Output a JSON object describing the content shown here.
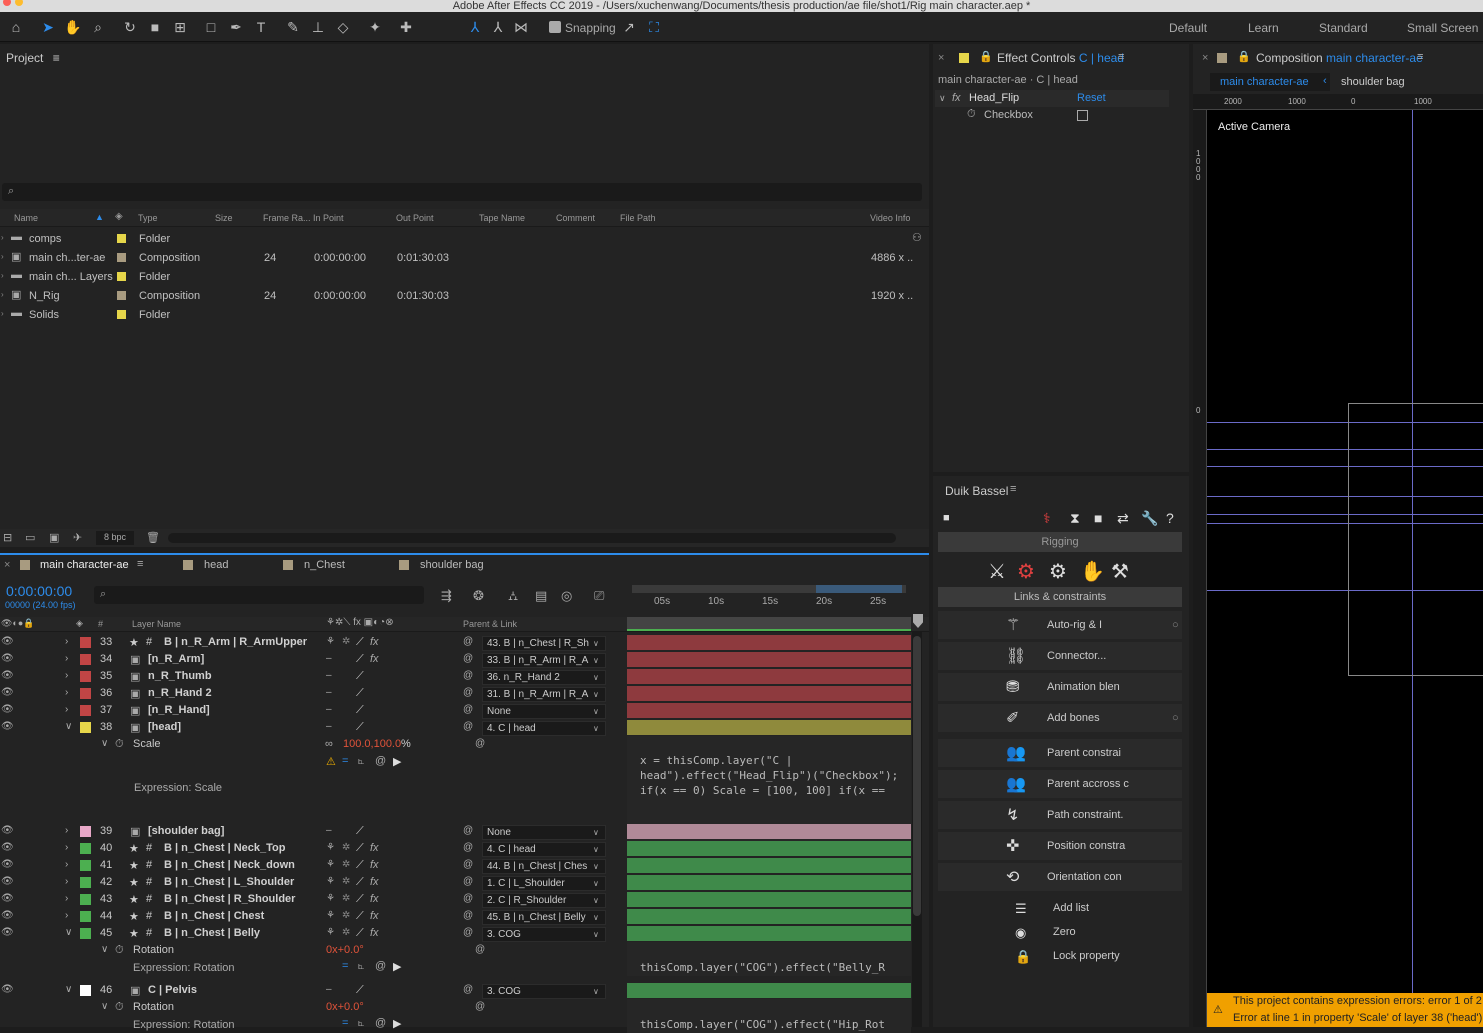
{
  "app": {
    "title": "Adobe After Effects CC 2019 - /Users/xuchenwang/Documents/thesis production/ae file/shot1/Rig main character.aep *"
  },
  "toolbar": {
    "snapping": "Snapping",
    "workspaces": [
      "Default",
      "Learn",
      "Standard",
      "Small Screen"
    ]
  },
  "project": {
    "title": "Project",
    "bpc": "8 bpc",
    "columns": [
      "Name",
      "Type",
      "Size",
      "Frame Ra...",
      "In Point",
      "Out Point",
      "Tape Name",
      "Comment",
      "File Path",
      "Video Info"
    ],
    "rows": [
      {
        "name": "comps",
        "type": "Folder",
        "fps": "",
        "in": "",
        "out": "",
        "info": "",
        "color": "#e6d64a"
      },
      {
        "name": "main ch...ter-ae",
        "type": "Composition",
        "fps": "24",
        "in": "0:00:00:00",
        "out": "0:01:30:03",
        "info": "4886 x ..",
        "color": "#a89b80"
      },
      {
        "name": "main ch... Layers",
        "type": "Folder",
        "fps": "",
        "in": "",
        "out": "",
        "info": "",
        "color": "#e6d64a"
      },
      {
        "name": "N_Rig",
        "type": "Composition",
        "fps": "24",
        "in": "0:00:00:00",
        "out": "0:01:30:03",
        "info": "1920 x ..",
        "color": "#a89b80"
      },
      {
        "name": "Solids",
        "type": "Folder",
        "fps": "",
        "in": "",
        "out": "",
        "info": "",
        "color": "#e6d64a"
      }
    ]
  },
  "effect_controls": {
    "tab": "Effect Controls",
    "tab_highlight": "C | head",
    "breadcrumb": "main character-ae · C | head",
    "effect": "Head_Flip",
    "reset": "Reset",
    "param": "Checkbox"
  },
  "composition": {
    "tab": "Composition",
    "tab_highlight": "main character-ae",
    "crumb1": "main character-ae",
    "crumb2": "shoulder bag",
    "ruler": [
      "2000",
      "1000",
      "0",
      "1000"
    ],
    "camera": "Active Camera",
    "vruler": "1 0 0 0",
    "vruler2": "0",
    "error1": "This project contains expression errors: error 1 of 2",
    "error2": "Error at line 1 in property 'Scale' of layer 38 ('head')"
  },
  "duik": {
    "title": "Duik Bassel",
    "rigging": "Rigging",
    "links": "Links & constraints",
    "buttons": [
      "Auto-rig & I",
      "Connector...",
      "Animation blen",
      "Add bones",
      "Parent constrai",
      "Parent accross c",
      "Path constraint.",
      "Position constra",
      "Orientation con"
    ],
    "extra": [
      "Add list",
      "Zero",
      "Lock property"
    ]
  },
  "timeline": {
    "tabs": [
      "main character-ae",
      "head",
      "n_Chest",
      "shoulder bag"
    ],
    "timecode": "0:00:00:00",
    "fps": "00000 (24.00 fps)",
    "col_layer": "Layer Name",
    "col_num": "#",
    "col_parent": "Parent & Link",
    "ruler": [
      "05s",
      "10s",
      "15s",
      "20s",
      "25s"
    ],
    "layers": [
      {
        "num": "33",
        "name": "B | n_R_Arm | R_ArmUpper",
        "parent": "43. B | n_Chest | R_Sh",
        "color": "#c14545",
        "bar": "#8e3a3e",
        "shape": true
      },
      {
        "num": "34",
        "name": "[n_R_Arm]",
        "parent": "33. B | n_R_Arm | R_A",
        "color": "#c14545",
        "bar": "#8e3a3e",
        "shape": false
      },
      {
        "num": "35",
        "name": "n_R_Thumb",
        "parent": "36. n_R_Hand 2",
        "color": "#c14545",
        "bar": "#8e3a3e",
        "shape": false
      },
      {
        "num": "36",
        "name": "n_R_Hand 2",
        "parent": "31. B | n_R_Arm | R_A",
        "color": "#c14545",
        "bar": "#8e3a3e",
        "shape": false
      },
      {
        "num": "37",
        "name": "[n_R_Hand]",
        "parent": "None",
        "color": "#c14545",
        "bar": "#8e3a3e",
        "shape": false
      },
      {
        "num": "38",
        "name": "[head]",
        "parent": "4. C | head",
        "color": "#e6d64a",
        "bar": "#8f8a3c",
        "shape": false
      }
    ],
    "scale": {
      "label": "Scale",
      "value": "100.0,100.0",
      "unit": "%",
      "expr_label": "Expression: Scale",
      "expr": "x = thisComp.layer(\"C | head\").effect(\"Head_Flip\")(\"Checkbox\");\nif(x == 0) Scale = [100, 100] if(x =="
    },
    "layers2": [
      {
        "num": "39",
        "name": "[shoulder bag]",
        "parent": "None",
        "color": "#e8a8c8",
        "bar": "#b08a98"
      },
      {
        "num": "40",
        "name": "B | n_Chest | Neck_Top",
        "parent": "4. C | head",
        "color": "#4caf50",
        "bar": "#3f8a4a"
      },
      {
        "num": "41",
        "name": "B | n_Chest | Neck_down",
        "parent": "44. B | n_Chest | Ches",
        "color": "#4caf50",
        "bar": "#3f8a4a"
      },
      {
        "num": "42",
        "name": "B | n_Chest | L_Shoulder",
        "parent": "1. C | L_Shoulder",
        "color": "#4caf50",
        "bar": "#3f8a4a"
      },
      {
        "num": "43",
        "name": "B | n_Chest | R_Shoulder",
        "parent": "2. C | R_Shoulder",
        "color": "#4caf50",
        "bar": "#3f8a4a"
      },
      {
        "num": "44",
        "name": "B | n_Chest | Chest",
        "parent": "45. B | n_Chest | Belly",
        "color": "#4caf50",
        "bar": "#3f8a4a"
      },
      {
        "num": "45",
        "name": "B | n_Chest | Belly",
        "parent": "3. COG",
        "color": "#4caf50",
        "bar": "#3f8a4a"
      }
    ],
    "rotation": {
      "label": "Rotation",
      "value": "0x+0.0°",
      "expr_label": "Expression: Rotation",
      "expr": "thisComp.layer(\"COG\").effect(\"Belly_R"
    },
    "pelvis": {
      "num": "46",
      "name": "C | Pelvis",
      "parent": "3. COG",
      "color": "#ffffff",
      "bar": "#3f8a4a"
    },
    "rotation2": {
      "label": "Rotation",
      "value": "0x+0.0°",
      "expr_label": "Expression: Rotation",
      "expr": "thisComp.layer(\"COG\").effect(\"Hip_Rot"
    }
  }
}
